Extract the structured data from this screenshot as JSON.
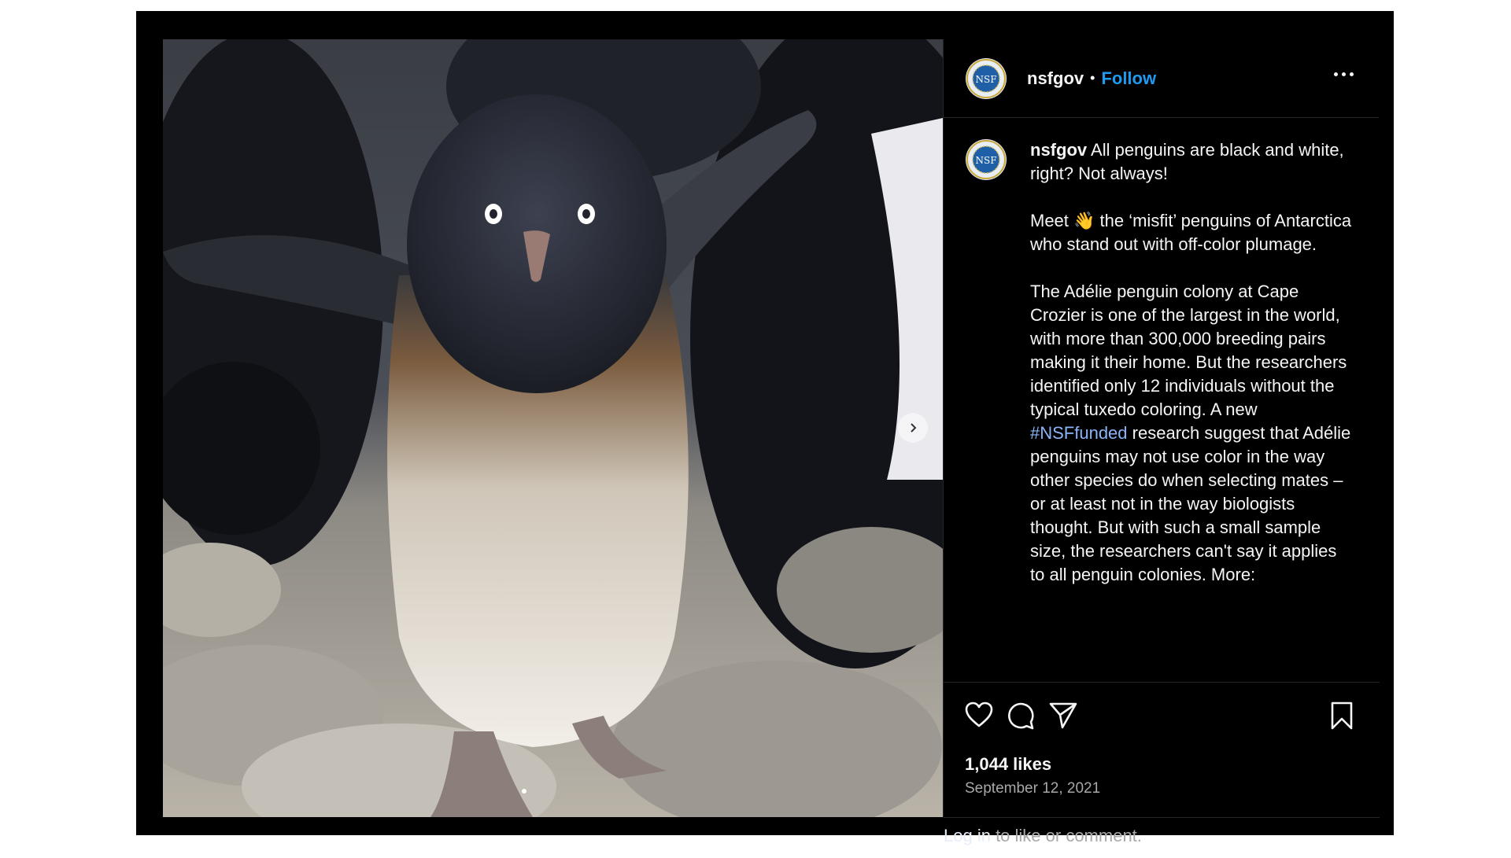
{
  "post": {
    "username": "nsfgov",
    "separator": "•",
    "follow_label": "Follow",
    "avatar_text": "NSF",
    "caption_lines": [
      "All penguins are black and white, right? Not always!",
      "",
      "Meet 👋 the ‘misfit’ penguins of Antarctica who stand out with off-color plumage.",
      "",
      "The Adélie penguin colony at Cape Crozier is one of the largest in the world, with more than 300,000 breeding pairs making it their home. But the researchers identified only 12 individuals without the typical tuxedo coloring. A new",
      "#NSFfunded",
      "research suggest that Adélie penguins may not use color in the way other species do when selecting mates – or at least not in the way biologists thought. But with such a small sample size, the researchers can't say it applies to all penguin colonies. More:"
    ],
    "likes": "1,044 likes",
    "date": "September 12, 2021",
    "login_link": "Log in",
    "login_rest": " to like or comment."
  },
  "icons": {
    "like": "heart-icon",
    "comment": "comment-icon",
    "share": "paper-plane-icon",
    "save": "bookmark-icon",
    "more": "more-options-icon",
    "next": "chevron-right-icon"
  },
  "colors": {
    "background": "#000000",
    "follow": "#1d9bf0",
    "hashtag": "#8ab4f8",
    "muted": "#a8a8a8"
  }
}
